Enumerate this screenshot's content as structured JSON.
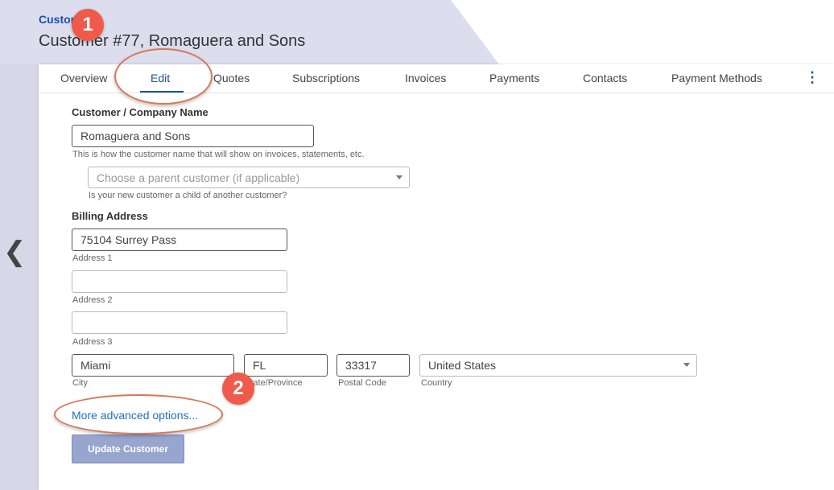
{
  "header": {
    "breadcrumb": "Customers",
    "title": "Customer #77, Romaguera and Sons"
  },
  "tabs": [
    {
      "label": "Overview"
    },
    {
      "label": "Edit",
      "active": true
    },
    {
      "label": "Quotes"
    },
    {
      "label": "Subscriptions"
    },
    {
      "label": "Invoices"
    },
    {
      "label": "Payments"
    },
    {
      "label": "Contacts"
    },
    {
      "label": "Payment Methods"
    }
  ],
  "icons": {
    "more": "more-vertical-icon",
    "back": "chevron-left-icon",
    "more_glyph": "⋮",
    "back_glyph": "❮"
  },
  "form": {
    "company_name_label": "Customer / Company Name",
    "company_name_value": "Romaguera and Sons",
    "company_name_help": "This is how the customer name that will show on invoices, statements, etc.",
    "parent_customer_placeholder": "Choose a parent customer (if applicable)",
    "parent_customer_help": "Is your new customer a child of another customer?",
    "billing_address_label": "Billing Address",
    "address1_value": "75104 Surrey Pass",
    "address1_label": "Address 1",
    "address2_value": "",
    "address2_label": "Address 2",
    "address3_value": "",
    "address3_label": "Address 3",
    "city_value": "Miami",
    "city_label": "City",
    "state_value": "FL",
    "state_label": "State/Province",
    "postal_value": "33317",
    "postal_label": "Postal Code",
    "country_value": "United States",
    "country_label": "Country",
    "advanced_link": "More advanced options...",
    "submit_label": "Update Customer"
  },
  "annotations": {
    "badge1": "1",
    "badge2": "2",
    "accent_color": "#f05a4a"
  }
}
